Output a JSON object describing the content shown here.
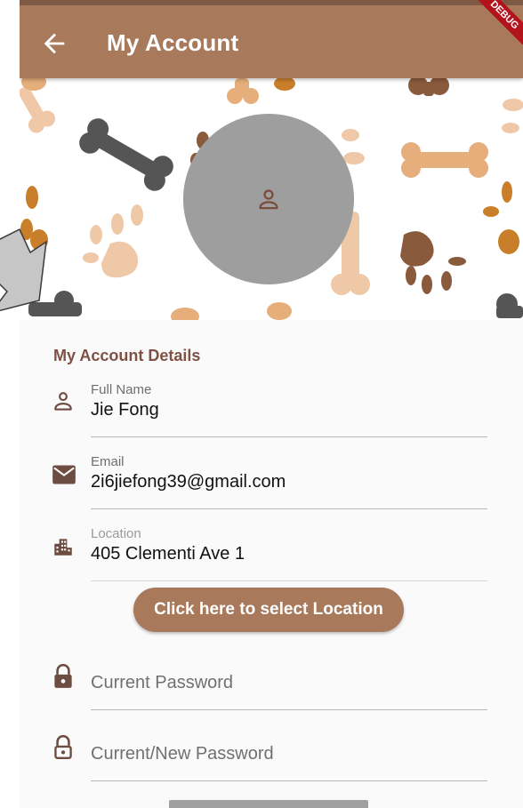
{
  "appbar": {
    "title": "My Account",
    "debug_label": "DEBUG",
    "color": "#a87a5b"
  },
  "profile": {
    "avatar_icon": "person-outline-icon"
  },
  "details": {
    "section_title": "My Account Details",
    "full_name_label": "Full Name",
    "full_name_value": "Jie Fong",
    "email_label": "Email",
    "email_value": "2i6jiefong39@gmail.com",
    "location_label": "Location",
    "location_value": "405 Clementi Ave 1",
    "select_location_button": "Click here to select Location",
    "current_password_placeholder": "Current Password",
    "new_password_placeholder": "Current/New Password"
  },
  "colors": {
    "accent": "#a87a5b",
    "icon_brown": "#6d4c41",
    "section_title": "#7e5144"
  }
}
